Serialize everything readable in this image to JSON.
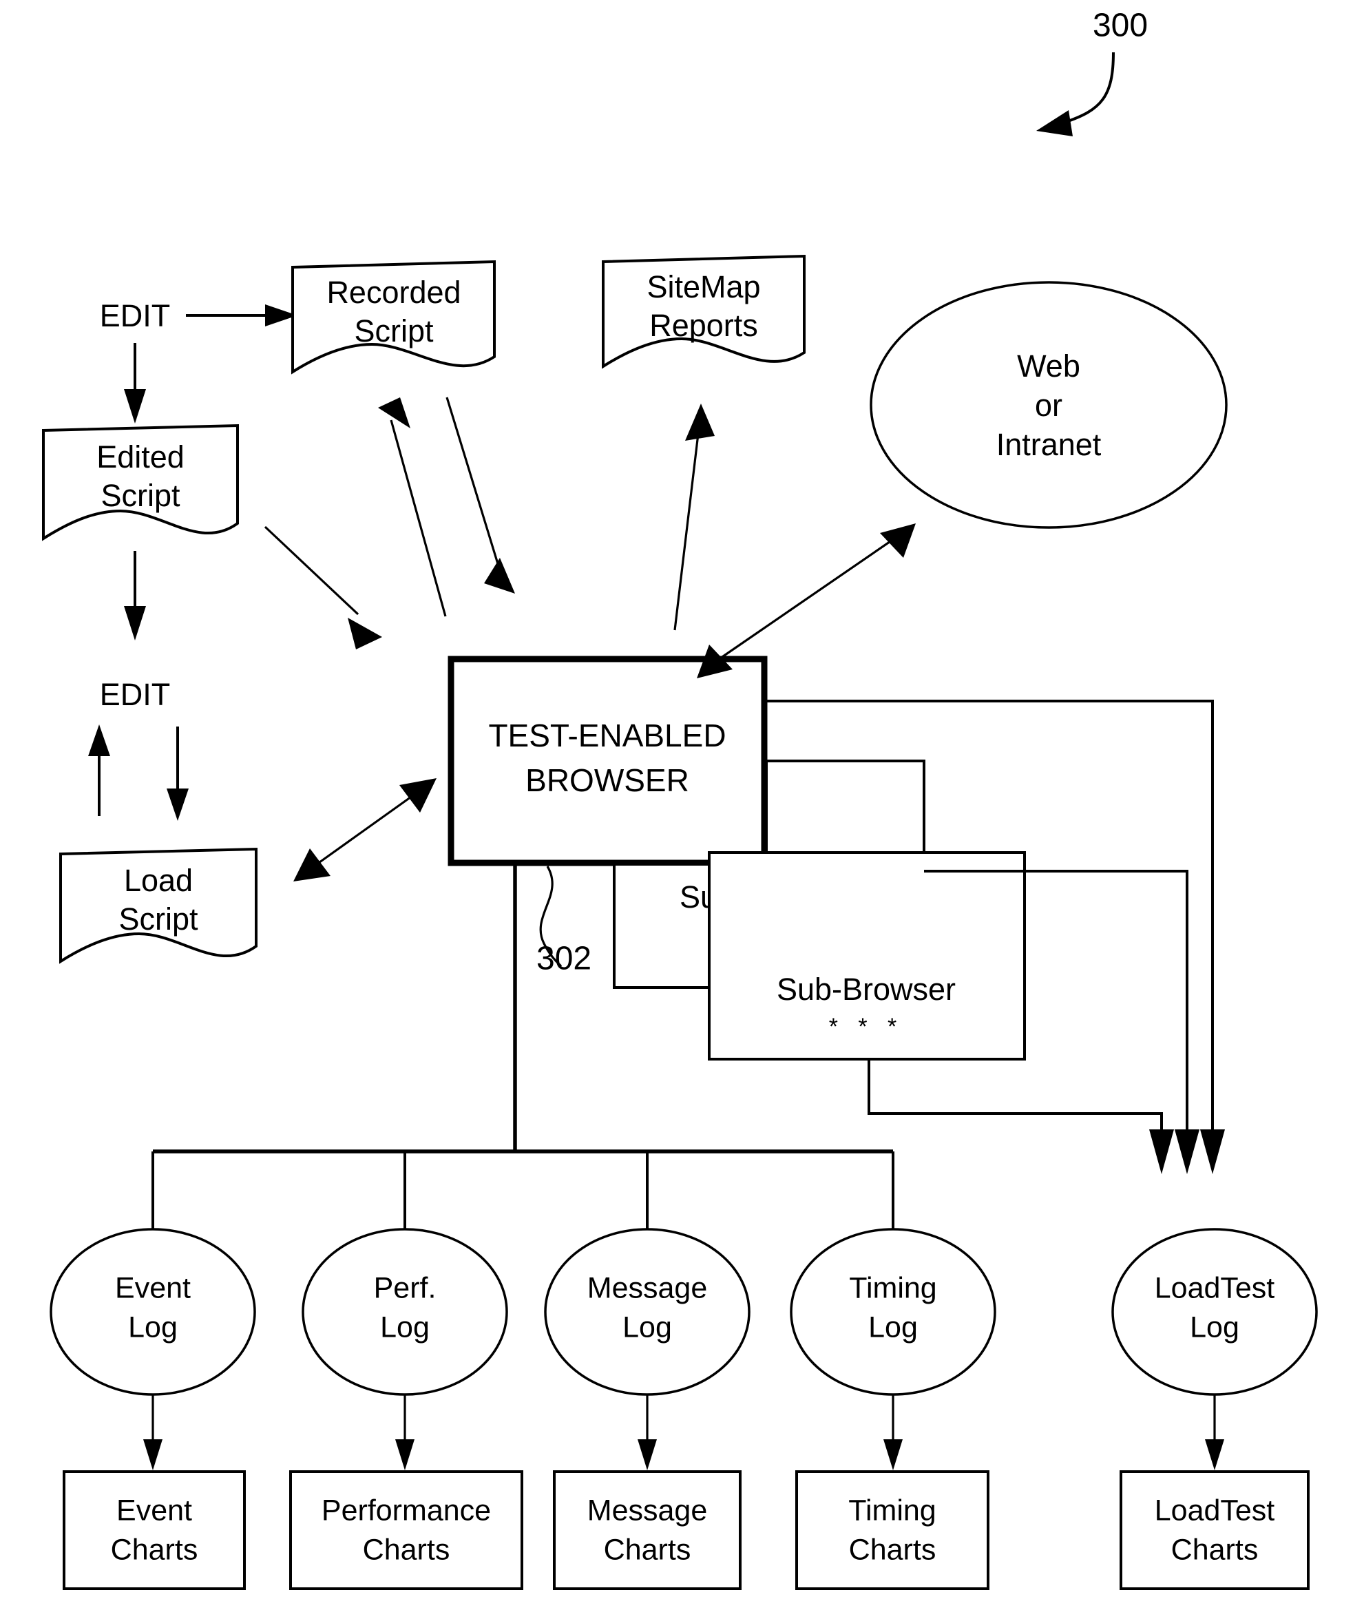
{
  "figure": {
    "reference_numeral": "300",
    "inner_reference_numeral": "302"
  },
  "nodes": {
    "edit_top": {
      "label": "EDIT"
    },
    "edit_bottom": {
      "label": "EDIT"
    },
    "recorded_script": {
      "line1": "Recorded",
      "line2": "Script"
    },
    "edited_script": {
      "line1": "Edited",
      "line2": "Script"
    },
    "load_script": {
      "line1": "Load",
      "line2": "Script"
    },
    "sitemap_reports": {
      "line1": "SiteMap",
      "line2": "Reports"
    },
    "web_or_intranet": {
      "line1": "Web",
      "line2": "or",
      "line3": "Intranet"
    },
    "test_enabled_browser": {
      "line1": "TEST-ENABLED",
      "line2": "BROWSER"
    },
    "sub_browser_1": {
      "label": "Sub-Browser",
      "ellipsis": "* * *"
    },
    "sub_browser_2": {
      "label": "Sub-Browser",
      "ellipsis": "* * *"
    }
  },
  "logs": [
    {
      "id": "event-log",
      "line1": "Event",
      "line2": "Log"
    },
    {
      "id": "perf-log",
      "line1": "Perf.",
      "line2": "Log"
    },
    {
      "id": "message-log",
      "line1": "Message",
      "line2": "Log"
    },
    {
      "id": "timing-log",
      "line1": "Timing",
      "line2": "Log"
    },
    {
      "id": "loadtest-log",
      "line1": "LoadTest",
      "line2": "Log"
    }
  ],
  "charts": [
    {
      "id": "event-charts",
      "line1": "Event",
      "line2": "Charts"
    },
    {
      "id": "performance-charts",
      "line1": "Performance",
      "line2": "Charts"
    },
    {
      "id": "message-charts",
      "line1": "Message",
      "line2": "Charts"
    },
    {
      "id": "timing-charts",
      "line1": "Timing",
      "line2": "Charts"
    },
    {
      "id": "loadtest-charts",
      "line1": "LoadTest",
      "line2": "Charts"
    }
  ],
  "colors": {
    "ink": "#000000",
    "paper": "#ffffff"
  }
}
